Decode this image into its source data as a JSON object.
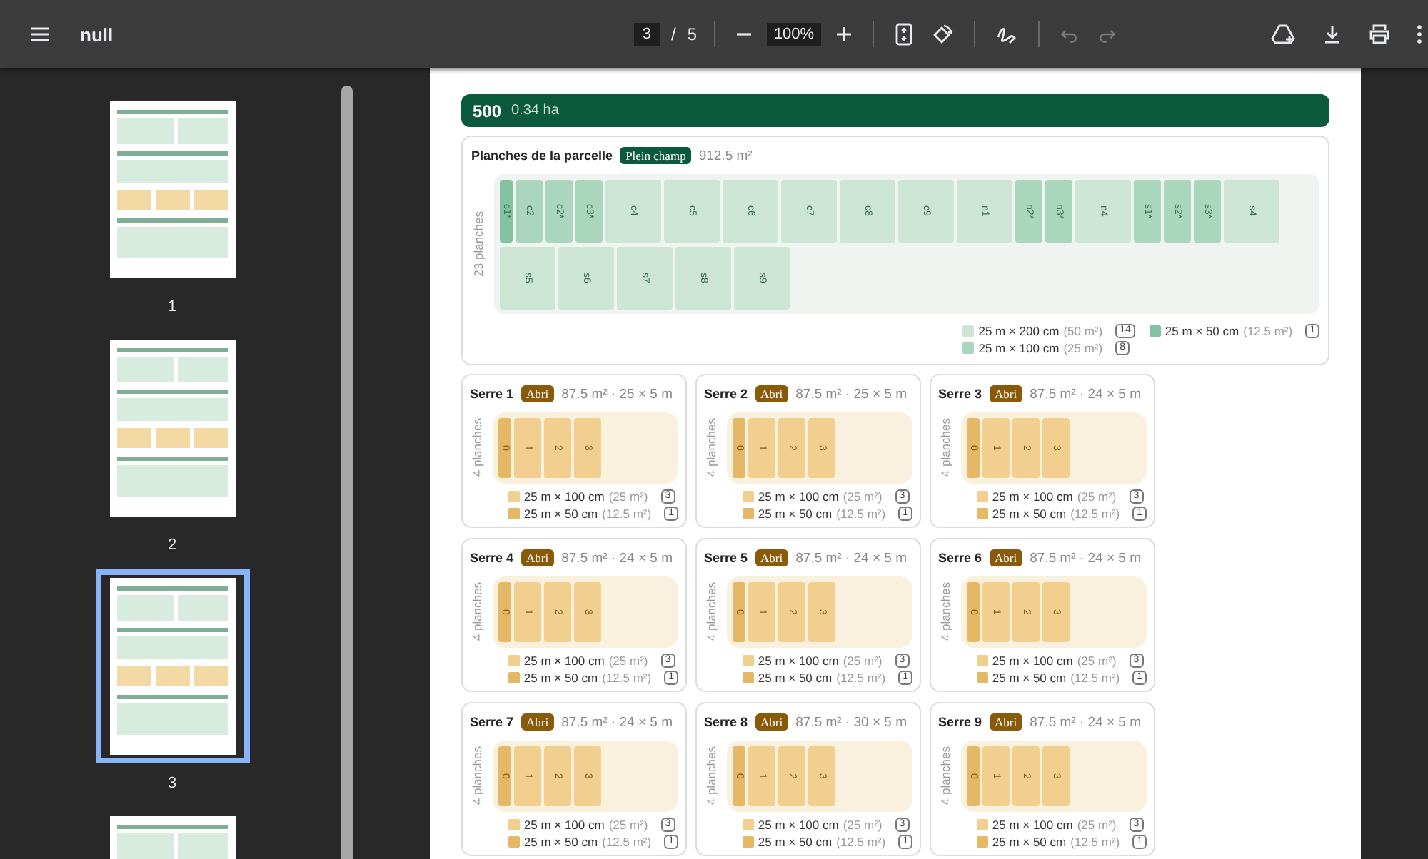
{
  "toolbar": {
    "title": "null",
    "page": "3",
    "page_separator": "/",
    "page_count": "5",
    "zoom": "100%",
    "history": [
      {
        "kind": "undo",
        "disabled": true
      },
      {
        "kind": "redo",
        "disabled": true
      }
    ]
  },
  "thumbnails": [
    {
      "label": "1",
      "selected": false
    },
    {
      "label": "2",
      "selected": false
    },
    {
      "label": "3",
      "selected": true
    },
    {
      "selected": false
    }
  ],
  "plot": {
    "number": "500",
    "area": "0.34 ha"
  },
  "field": {
    "title": "Planches de la parcelle",
    "tag": "Plein champ",
    "area": "912.5 m²",
    "count_label": "23 planches",
    "beds": [
      {
        "label": "c1*",
        "kind": "narrow"
      },
      {
        "label": "c2",
        "kind": "medium"
      },
      {
        "label": "c2*",
        "kind": "medium"
      },
      {
        "label": "c3*",
        "kind": "medium"
      },
      {
        "label": "c4",
        "kind": "wide"
      },
      {
        "label": "c5",
        "kind": "wide"
      },
      {
        "label": "c6",
        "kind": "wide"
      },
      {
        "label": "c7",
        "kind": "wide"
      },
      {
        "label": "c8",
        "kind": "wide"
      },
      {
        "label": "c9",
        "kind": "wide"
      },
      {
        "label": "n1",
        "kind": "wide"
      },
      {
        "label": "n2*",
        "kind": "medium"
      },
      {
        "label": "n3*",
        "kind": "medium"
      },
      {
        "label": "n4",
        "kind": "wide"
      },
      {
        "label": "s1*",
        "kind": "medium"
      },
      {
        "label": "s2*",
        "kind": "medium"
      },
      {
        "label": "s3*",
        "kind": "medium"
      },
      {
        "label": "s4",
        "kind": "wide"
      },
      {
        "label": "s5",
        "kind": "wide"
      },
      {
        "label": "s6",
        "kind": "wide"
      },
      {
        "label": "s7",
        "kind": "wide"
      },
      {
        "label": "s8",
        "kind": "wide"
      },
      {
        "label": "s9",
        "kind": "wide"
      }
    ],
    "legend": [
      {
        "kind": "wide",
        "size": "25 m × 200 cm",
        "area": "(50 m²)",
        "count": "14",
        "color": "#cce5d4"
      },
      {
        "kind": "narrow",
        "size": "25 m × 50 cm",
        "area": "(12.5 m²)",
        "count": "1",
        "color": "#82c2a2"
      },
      {
        "kind": "medium",
        "size": "25 m × 100 cm",
        "area": "(25 m²)",
        "count": "8",
        "color": "#a9d6bd"
      }
    ]
  },
  "greenhouses": [
    {
      "name": "Serre 1",
      "tag": "Abri",
      "info": "87.5 m² · 25 × 5 m",
      "count_label": "4 planches",
      "beds": [
        {
          "label": "0",
          "kind": "narrow"
        },
        {
          "label": "1",
          "kind": "medium"
        },
        {
          "label": "2",
          "kind": "medium"
        },
        {
          "label": "3",
          "kind": "medium"
        }
      ],
      "legend": [
        {
          "kind": "medium",
          "size": "25 m × 100 cm",
          "area": "(25 m²)",
          "count": "3",
          "color": "#f1d08f"
        },
        {
          "kind": "narrow",
          "size": "25 m × 50 cm",
          "area": "(12.5 m²)",
          "count": "1",
          "color": "#e5b865"
        }
      ]
    },
    {
      "name": "Serre 2",
      "tag": "Abri",
      "info": "87.5 m² · 25 × 5 m",
      "count_label": "4 planches",
      "beds": [
        {
          "label": "0",
          "kind": "narrow"
        },
        {
          "label": "1",
          "kind": "medium"
        },
        {
          "label": "2",
          "kind": "medium"
        },
        {
          "label": "3",
          "kind": "medium"
        }
      ],
      "legend": [
        {
          "kind": "medium",
          "size": "25 m × 100 cm",
          "area": "(25 m²)",
          "count": "3",
          "color": "#f1d08f"
        },
        {
          "kind": "narrow",
          "size": "25 m × 50 cm",
          "area": "(12.5 m²)",
          "count": "1",
          "color": "#e5b865"
        }
      ]
    },
    {
      "name": "Serre 3",
      "tag": "Abri",
      "info": "87.5 m² · 24 × 5 m",
      "count_label": "4 planches",
      "beds": [
        {
          "label": "0",
          "kind": "narrow"
        },
        {
          "label": "1",
          "kind": "medium"
        },
        {
          "label": "2",
          "kind": "medium"
        },
        {
          "label": "3",
          "kind": "medium"
        }
      ],
      "legend": [
        {
          "kind": "medium",
          "size": "25 m × 100 cm",
          "area": "(25 m²)",
          "count": "3",
          "color": "#f1d08f"
        },
        {
          "kind": "narrow",
          "size": "25 m × 50 cm",
          "area": "(12.5 m²)",
          "count": "1",
          "color": "#e5b865"
        }
      ]
    },
    {
      "name": "Serre 4",
      "tag": "Abri",
      "info": "87.5 m² · 24 × 5 m",
      "count_label": "4 planches",
      "beds": [
        {
          "label": "0",
          "kind": "narrow"
        },
        {
          "label": "1",
          "kind": "medium"
        },
        {
          "label": "2",
          "kind": "medium"
        },
        {
          "label": "3",
          "kind": "medium"
        }
      ],
      "legend": [
        {
          "kind": "medium",
          "size": "25 m × 100 cm",
          "area": "(25 m²)",
          "count": "3",
          "color": "#f1d08f"
        },
        {
          "kind": "narrow",
          "size": "25 m × 50 cm",
          "area": "(12.5 m²)",
          "count": "1",
          "color": "#e5b865"
        }
      ]
    },
    {
      "name": "Serre 5",
      "tag": "Abri",
      "info": "87.5 m² · 24 × 5 m",
      "count_label": "4 planches",
      "beds": [
        {
          "label": "0",
          "kind": "narrow"
        },
        {
          "label": "1",
          "kind": "medium"
        },
        {
          "label": "2",
          "kind": "medium"
        },
        {
          "label": "3",
          "kind": "medium"
        }
      ],
      "legend": [
        {
          "kind": "medium",
          "size": "25 m × 100 cm",
          "area": "(25 m²)",
          "count": "3",
          "color": "#f1d08f"
        },
        {
          "kind": "narrow",
          "size": "25 m × 50 cm",
          "area": "(12.5 m²)",
          "count": "1",
          "color": "#e5b865"
        }
      ]
    },
    {
      "name": "Serre 6",
      "tag": "Abri",
      "info": "87.5 m² · 24 × 5 m",
      "count_label": "4 planches",
      "beds": [
        {
          "label": "0",
          "kind": "narrow"
        },
        {
          "label": "1",
          "kind": "medium"
        },
        {
          "label": "2",
          "kind": "medium"
        },
        {
          "label": "3",
          "kind": "medium"
        }
      ],
      "legend": [
        {
          "kind": "medium",
          "size": "25 m × 100 cm",
          "area": "(25 m²)",
          "count": "3",
          "color": "#f1d08f"
        },
        {
          "kind": "narrow",
          "size": "25 m × 50 cm",
          "area": "(12.5 m²)",
          "count": "1",
          "color": "#e5b865"
        }
      ]
    },
    {
      "name": "Serre 7",
      "tag": "Abri",
      "info": "87.5 m² · 24 × 5 m",
      "count_label": "4 planches",
      "beds": [
        {
          "label": "0",
          "kind": "narrow"
        },
        {
          "label": "1",
          "kind": "medium"
        },
        {
          "label": "2",
          "kind": "medium"
        },
        {
          "label": "3",
          "kind": "medium"
        }
      ],
      "legend": [
        {
          "kind": "medium",
          "size": "25 m × 100 cm",
          "area": "(25 m²)",
          "count": "3",
          "color": "#f1d08f"
        },
        {
          "kind": "narrow",
          "size": "25 m × 50 cm",
          "area": "(12.5 m²)",
          "count": "1",
          "color": "#e5b865"
        }
      ]
    },
    {
      "name": "Serre 8",
      "tag": "Abri",
      "info": "87.5 m² · 30 × 5 m",
      "count_label": "4 planches",
      "beds": [
        {
          "label": "0",
          "kind": "narrow"
        },
        {
          "label": "1",
          "kind": "medium"
        },
        {
          "label": "2",
          "kind": "medium"
        },
        {
          "label": "3",
          "kind": "medium"
        }
      ],
      "legend": [
        {
          "kind": "medium",
          "size": "25 m × 100 cm",
          "area": "(25 m²)",
          "count": "3",
          "color": "#f1d08f"
        },
        {
          "kind": "narrow",
          "size": "25 m × 50 cm",
          "area": "(12.5 m²)",
          "count": "1",
          "color": "#e5b865"
        }
      ]
    },
    {
      "name": "Serre 9",
      "tag": "Abri",
      "info": "87.5 m² · 24 × 5 m",
      "count_label": "4 planches",
      "beds": [
        {
          "label": "0",
          "kind": "narrow"
        },
        {
          "label": "1",
          "kind": "medium"
        },
        {
          "label": "2",
          "kind": "medium"
        },
        {
          "label": "3",
          "kind": "medium"
        }
      ],
      "legend": [
        {
          "kind": "medium",
          "size": "25 m × 100 cm",
          "area": "(25 m²)",
          "count": "3",
          "color": "#f1d08f"
        },
        {
          "kind": "narrow",
          "size": "25 m × 50 cm",
          "area": "(12.5 m²)",
          "count": "1",
          "color": "#e5b865"
        }
      ]
    }
  ]
}
